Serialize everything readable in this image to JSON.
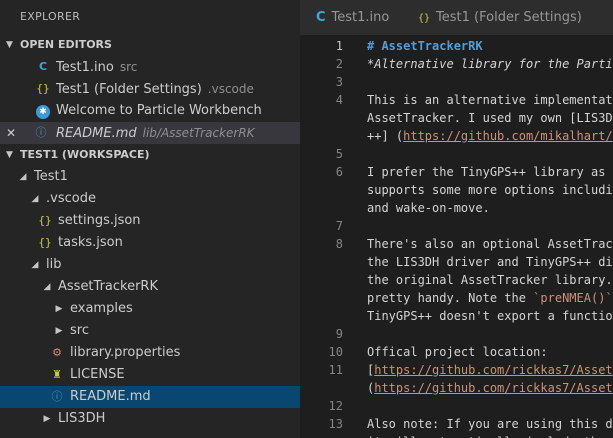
{
  "explorer": {
    "title": "EXPLORER",
    "open_editors": {
      "header": "OPEN EDITORS",
      "items": [
        {
          "name": "Test1.ino",
          "desc": "src",
          "icon": "c-file-icon"
        },
        {
          "name": "Test1 (Folder Settings)",
          "desc": ".vscode",
          "icon": "json-icon"
        },
        {
          "name": "Welcome to Particle Workbench",
          "desc": "",
          "icon": "particle-icon"
        },
        {
          "name": "README.md",
          "desc": "lib/AssetTrackerRK",
          "icon": "info-icon"
        }
      ]
    },
    "workspace": {
      "header": "TEST1 (WORKSPACE)",
      "tree": [
        {
          "label": "Test1"
        },
        {
          "label": ".vscode"
        },
        {
          "label": "settings.json"
        },
        {
          "label": "tasks.json"
        },
        {
          "label": "lib"
        },
        {
          "label": "AssetTrackerRK"
        },
        {
          "label": "examples"
        },
        {
          "label": "src"
        },
        {
          "label": "library.properties"
        },
        {
          "label": "LICENSE"
        },
        {
          "label": "README.md"
        },
        {
          "label": "LIS3DH"
        }
      ]
    }
  },
  "tabs": [
    {
      "label": "Test1.ino",
      "icon": "c-file-icon"
    },
    {
      "label": "Test1 (Folder Settings)",
      "icon": "json-icon"
    }
  ],
  "editor": {
    "lines": [
      {
        "n": "1",
        "parts": [
          {
            "t": "# AssetTrackerRK",
            "c": "h1"
          }
        ]
      },
      {
        "n": "2",
        "parts": [
          {
            "t": "*Alternative library for the Parti",
            "c": "em"
          }
        ]
      },
      {
        "n": "3",
        "parts": []
      },
      {
        "n": "4",
        "parts": [
          {
            "t": "This is an alternative implementat",
            "c": ""
          }
        ]
      },
      {
        "n": "",
        "parts": [
          {
            "t": "AssetTracker. I used my own [LIS3DH",
            "c": ""
          }
        ]
      },
      {
        "n": "",
        "parts": [
          {
            "t": "++] (",
            "c": ""
          },
          {
            "t": "https://github.com/mikalhart/",
            "c": "link"
          }
        ]
      },
      {
        "n": "5",
        "parts": []
      },
      {
        "n": "6",
        "parts": [
          {
            "t": "I prefer the TinyGPS++ library as ",
            "c": ""
          }
        ]
      },
      {
        "n": "",
        "parts": [
          {
            "t": "supports some more options includin",
            "c": ""
          }
        ]
      },
      {
        "n": "",
        "parts": [
          {
            "t": "and wake-on-move.",
            "c": ""
          }
        ]
      },
      {
        "n": "7",
        "parts": []
      },
      {
        "n": "8",
        "parts": [
          {
            "t": "There's also an optional AssetTrack",
            "c": ""
          }
        ]
      },
      {
        "n": "",
        "parts": [
          {
            "t": "the LIS3DH driver and TinyGPS++ di",
            "c": ""
          }
        ]
      },
      {
        "n": "",
        "parts": [
          {
            "t": "the original AssetTracker library.",
            "c": ""
          }
        ]
      },
      {
        "n": "",
        "parts": [
          {
            "t": "pretty handy. Note the ",
            "c": ""
          },
          {
            "t": "`preNMEA()`",
            "c": "inl"
          }
        ]
      },
      {
        "n": "",
        "parts": [
          {
            "t": "TinyGPS++ doesn't export a functio",
            "c": ""
          }
        ]
      },
      {
        "n": "9",
        "parts": []
      },
      {
        "n": "10",
        "parts": [
          {
            "t": "Offical project location:",
            "c": ""
          }
        ]
      },
      {
        "n": "11",
        "parts": [
          {
            "t": "[",
            "c": ""
          },
          {
            "t": "https://github.com/rickkas7/Asset",
            "c": "link"
          }
        ]
      },
      {
        "n": "",
        "parts": [
          {
            "t": "(",
            "c": ""
          },
          {
            "t": "https://github.com/rickkas7/Asset",
            "c": "link"
          }
        ]
      },
      {
        "n": "12",
        "parts": []
      },
      {
        "n": "13",
        "parts": [
          {
            "t": "Also note: If you are using this d",
            "c": ""
          }
        ]
      },
      {
        "n": "",
        "parts": [
          {
            "t": "it will automatically include the ",
            "c": ""
          }
        ]
      }
    ]
  },
  "colors": {
    "sidebar_bg": "#252526",
    "editor_bg": "#1e1e1e",
    "selection": "#094771",
    "heading": "#569cd6",
    "link": "#ce9178"
  }
}
